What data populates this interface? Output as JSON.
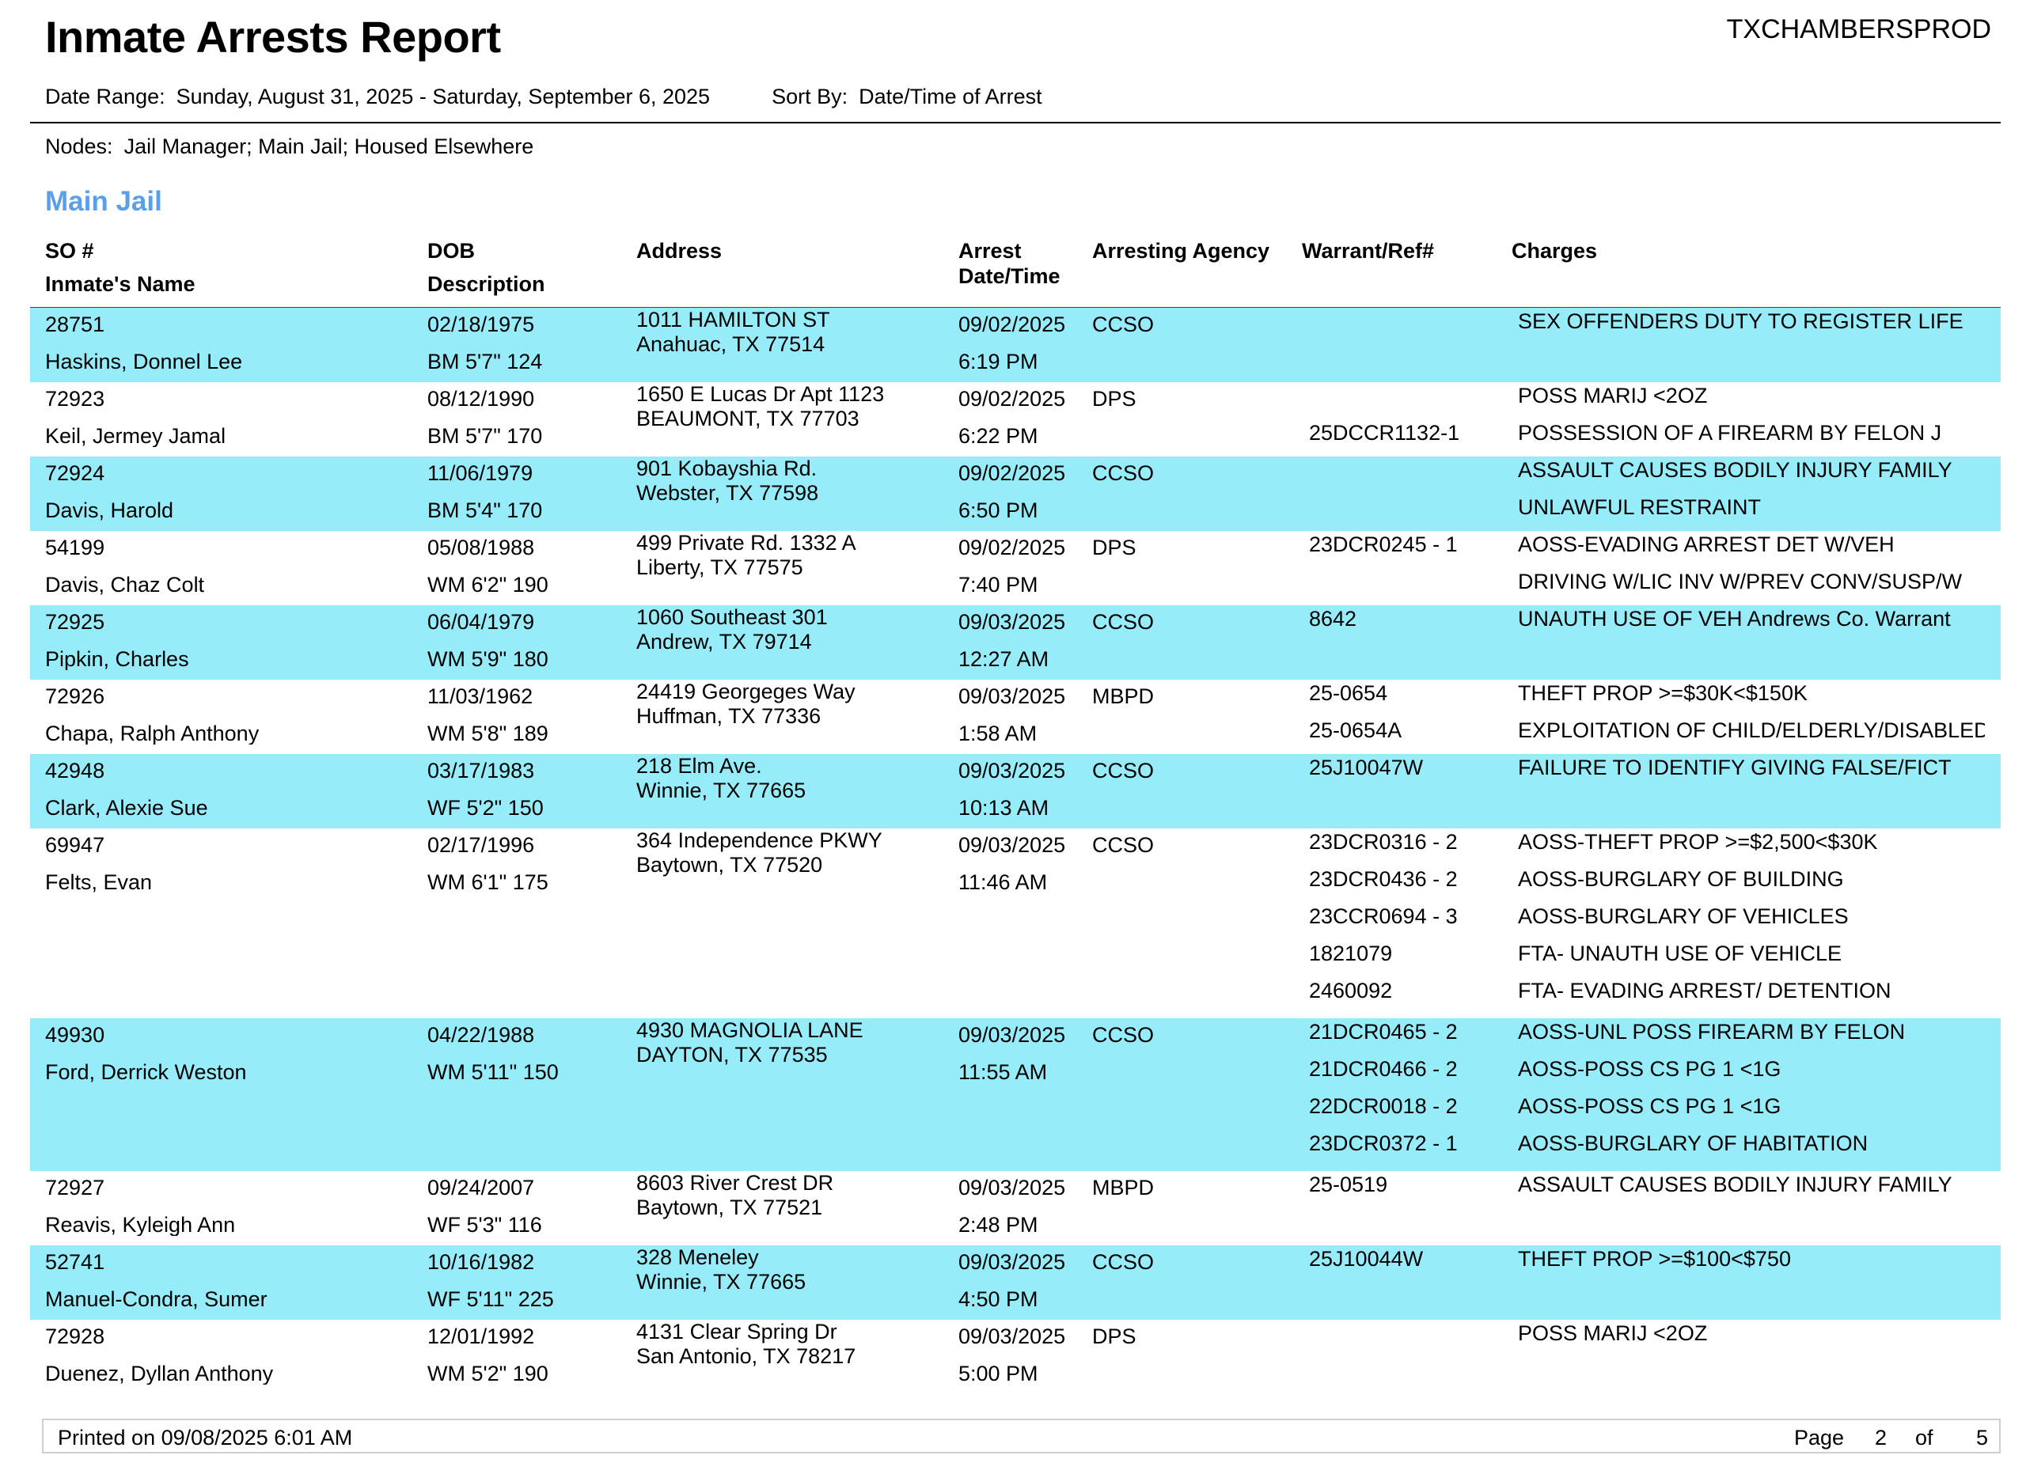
{
  "report": {
    "title": "Inmate Arrests Report",
    "system": "TXCHAMBERSPROD",
    "date_range_label": "Date Range:",
    "date_range": "Sunday, August 31, 2025 - Saturday, September 6, 2025",
    "sort_label": "Sort By:",
    "sort_by": "Date/Time of Arrest",
    "nodes_label": "Nodes:",
    "nodes": "Jail Manager; Main Jail; Housed Elsewhere",
    "section": "Main Jail"
  },
  "columns": {
    "so": "SO #",
    "name": "Inmate's Name",
    "dob": "DOB",
    "description": "Description",
    "address": "Address",
    "arrest_line1": "Arrest",
    "arrest_line2": "Date/Time",
    "agency": "Arresting Agency",
    "warrant": "Warrant/Ref#",
    "charges": "Charges"
  },
  "colors": {
    "row_highlight": "#97ecf9",
    "section_title": "#5aa0e8",
    "header_rule": "#3a3a8c"
  },
  "rows": [
    {
      "so": "28751",
      "name": "Haskins, Donnel Lee",
      "dob": "02/18/1975",
      "desc": "BM  5'7\" 124",
      "addr1": "1011 HAMILTON ST",
      "addr2": "Anahuac, TX 77514",
      "date": "09/02/2025",
      "time": "6:19 PM",
      "agency": "CCSO",
      "warrants": [
        "",
        ""
      ],
      "charges": [
        "SEX OFFENDERS DUTY TO REGISTER LIFE",
        ""
      ]
    },
    {
      "so": "72923",
      "name": "Keil, Jermey Jamal",
      "dob": "08/12/1990",
      "desc": "BM  5'7\" 170",
      "addr1": "1650 E Lucas Dr Apt 1123",
      "addr2": "BEAUMONT, TX 77703",
      "date": "09/02/2025",
      "time": "6:22 PM",
      "agency": "DPS",
      "warrants": [
        "",
        "25DCCR1132-1"
      ],
      "charges": [
        "POSS MARIJ <2OZ",
        "POSSESSION OF A FIREARM BY FELON J"
      ]
    },
    {
      "so": "72924",
      "name": "Davis, Harold",
      "dob": "11/06/1979",
      "desc": "BM  5'4\" 170",
      "addr1": "901 Kobayshia Rd.",
      "addr2": "Webster, TX 77598",
      "date": "09/02/2025",
      "time": "6:50 PM",
      "agency": "CCSO",
      "warrants": [
        "",
        ""
      ],
      "charges": [
        "ASSAULT CAUSES BODILY INJURY FAMILY",
        "UNLAWFUL RESTRAINT"
      ]
    },
    {
      "so": "54199",
      "name": "Davis, Chaz Colt",
      "dob": "05/08/1988",
      "desc": "WM  6'2\" 190",
      "addr1": "499 Private Rd. 1332 A",
      "addr2": "Liberty, TX 77575",
      "date": "09/02/2025",
      "time": "7:40 PM",
      "agency": "DPS",
      "warrants": [
        "23DCR0245 - 1",
        ""
      ],
      "charges": [
        "AOSS-EVADING ARREST DET W/VEH",
        "DRIVING W/LIC INV W/PREV CONV/SUSP/W"
      ]
    },
    {
      "so": "72925",
      "name": "Pipkin, Charles",
      "dob": "06/04/1979",
      "desc": "WM  5'9\" 180",
      "addr1": "1060 Southeast 301",
      "addr2": "Andrew, TX 79714",
      "date": "09/03/2025",
      "time": "12:27 AM",
      "agency": "CCSO",
      "warrants": [
        "8642",
        ""
      ],
      "charges": [
        "UNAUTH USE OF VEH Andrews Co. Warrant",
        ""
      ]
    },
    {
      "so": "72926",
      "name": "Chapa, Ralph Anthony",
      "dob": "11/03/1962",
      "desc": "WM  5'8\" 189",
      "addr1": "24419 Georgeges Way",
      "addr2": "Huffman, TX 77336",
      "date": "09/03/2025",
      "time": "1:58 AM",
      "agency": "MBPD",
      "warrants": [
        "25-0654",
        "25-0654A"
      ],
      "charges": [
        "THEFT PROP >=$30K<$150K",
        "EXPLOITATION OF CHILD/ELDERLY/DISABLED"
      ]
    },
    {
      "so": "42948",
      "name": "Clark, Alexie Sue",
      "dob": "03/17/1983",
      "desc": "WF  5'2\" 150",
      "addr1": "218 Elm Ave.",
      "addr2": "Winnie, TX 77665",
      "date": "09/03/2025",
      "time": "10:13 AM",
      "agency": "CCSO",
      "warrants": [
        "25J10047W",
        ""
      ],
      "charges": [
        "FAILURE TO IDENTIFY GIVING FALSE/FICT",
        ""
      ]
    },
    {
      "so": "69947",
      "name": "Felts, Evan",
      "dob": "02/17/1996",
      "desc": "WM  6'1\" 175",
      "addr1": "364 Independence PKWY",
      "addr2": "Baytown, TX 77520",
      "date": "09/03/2025",
      "time": "11:46 AM",
      "agency": "CCSO",
      "warrants": [
        "23DCR0316 - 2",
        "23DCR0436 - 2",
        "23CCR0694 - 3",
        "1821079",
        "2460092"
      ],
      "charges": [
        "AOSS-THEFT PROP >=$2,500<$30K",
        "AOSS-BURGLARY OF BUILDING",
        "AOSS-BURGLARY OF VEHICLES",
        "FTA- UNAUTH USE OF VEHICLE",
        "FTA- EVADING ARREST/ DETENTION"
      ]
    },
    {
      "so": "49930",
      "name": "Ford, Derrick Weston",
      "dob": "04/22/1988",
      "desc": "WM  5'11\" 150",
      "addr1": "4930 MAGNOLIA LANE",
      "addr2": "DAYTON, TX 77535",
      "date": "09/03/2025",
      "time": "11:55 AM",
      "agency": "CCSO",
      "warrants": [
        "21DCR0465 - 2",
        "21DCR0466 - 2",
        "22DCR0018 - 2",
        "23DCR0372 - 1"
      ],
      "charges": [
        "AOSS-UNL POSS FIREARM BY FELON",
        "AOSS-POSS CS PG 1 <1G",
        "AOSS-POSS CS PG 1 <1G",
        "AOSS-BURGLARY OF HABITATION"
      ]
    },
    {
      "so": "72927",
      "name": "Reavis, Kyleigh Ann",
      "dob": "09/24/2007",
      "desc": "WF  5'3\" 116",
      "addr1": "8603 River Crest DR",
      "addr2": "Baytown, TX 77521",
      "date": "09/03/2025",
      "time": "2:48 PM",
      "agency": "MBPD",
      "warrants": [
        "25-0519",
        ""
      ],
      "charges": [
        "ASSAULT CAUSES BODILY INJURY FAMILY",
        ""
      ]
    },
    {
      "so": "52741",
      "name": "Manuel-Condra, Sumer",
      "dob": "10/16/1982",
      "desc": "WF  5'11\" 225",
      "addr1": "328 Meneley",
      "addr2": "Winnie, TX 77665",
      "date": "09/03/2025",
      "time": "4:50 PM",
      "agency": "CCSO",
      "warrants": [
        "25J10044W",
        ""
      ],
      "charges": [
        "THEFT PROP >=$100<$750",
        ""
      ]
    },
    {
      "so": "72928",
      "name": "Duenez, Dyllan Anthony",
      "dob": "12/01/1992",
      "desc": "WM  5'2\" 190",
      "addr1": "4131 Clear Spring Dr",
      "addr2": "San Antonio, TX 78217",
      "date": "09/03/2025",
      "time": "5:00 PM",
      "agency": "DPS",
      "warrants": [
        "",
        ""
      ],
      "charges": [
        "POSS MARIJ <2OZ",
        ""
      ]
    }
  ],
  "footer": {
    "printed": "Printed on 09/08/2025 6:01 AM",
    "page_label": "Page",
    "page": "2",
    "of_label": "of",
    "total": "5"
  }
}
